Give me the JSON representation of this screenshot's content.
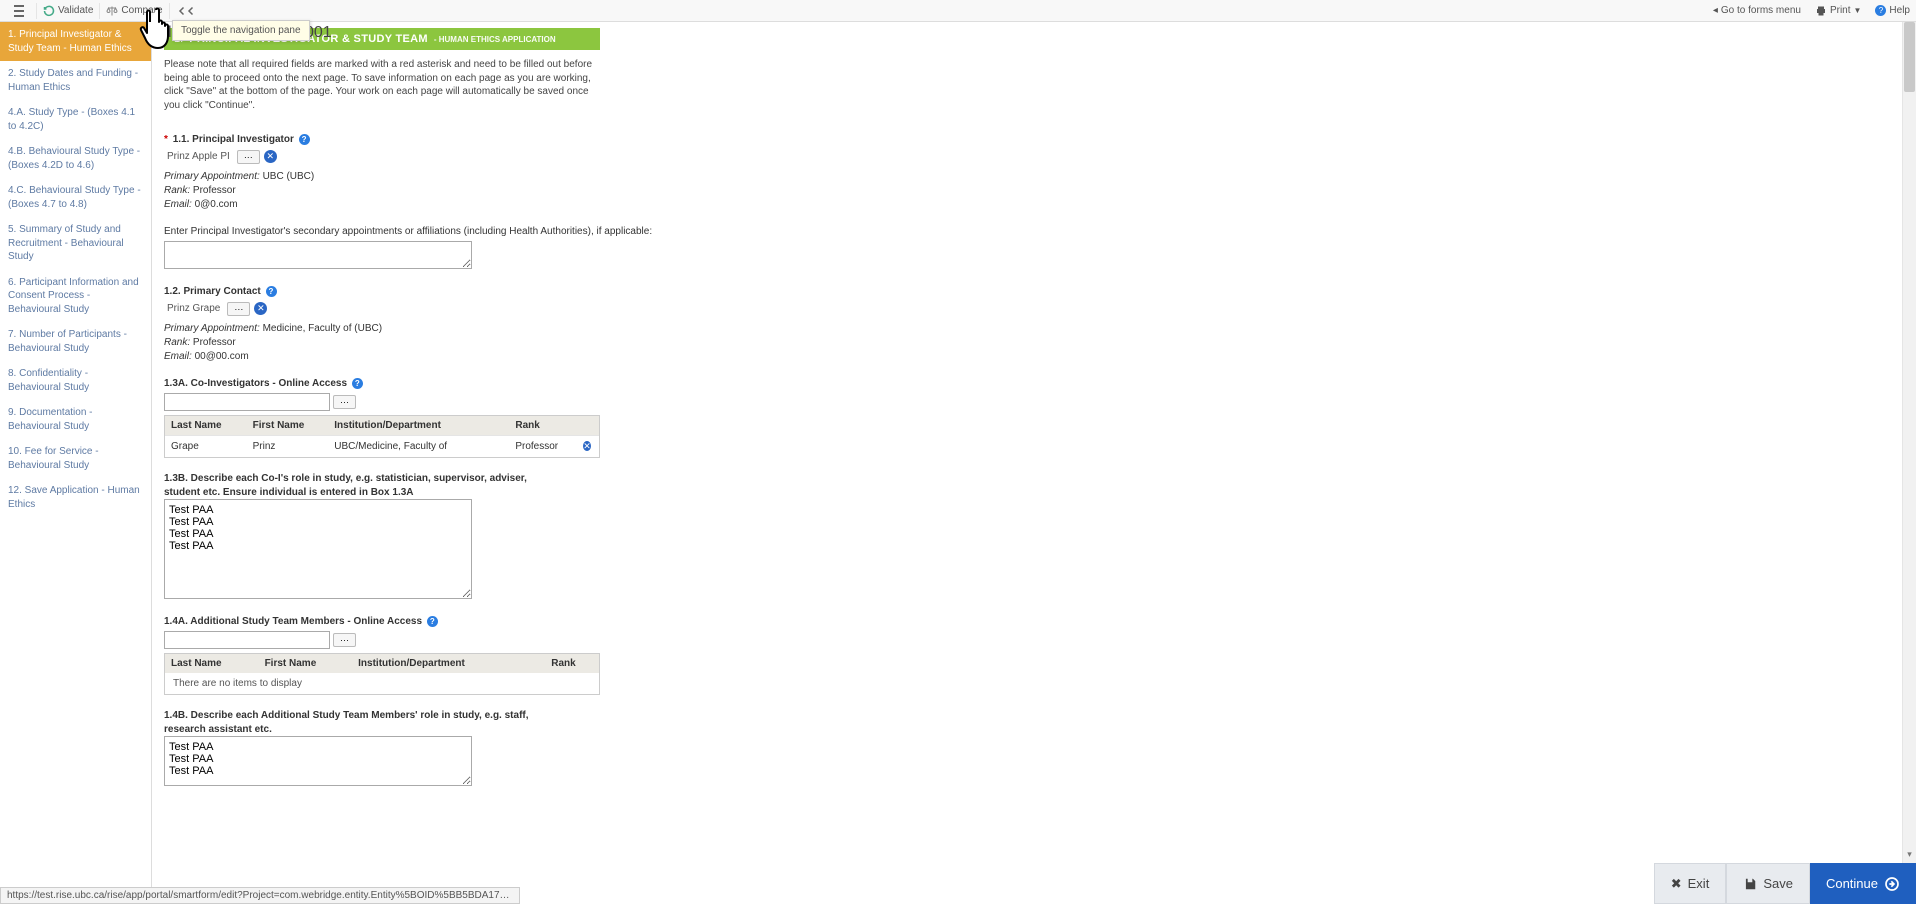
{
  "topbar": {
    "validate": "Validate",
    "compare": "Compare",
    "go_forms": "Go to forms menu",
    "print": "Print",
    "help": "Help",
    "tooltip": "Toggle the navigation pane"
  },
  "title": "Editing: H00-00019-A001",
  "banner": {
    "num": "1.",
    "title": "PRINCIPAL INVESTIGATOR & STUDY TEAM",
    "sub": "- HUMAN ETHICS APPLICATION"
  },
  "note": "Please note that all required fields are marked with a red asterisk and need to be filled out before being able to proceed onto the next page. To save information on each page as you are working, click \"Save\" at the bottom of the page. Your work on each page will automatically be saved once you click \"Continue\".",
  "nav": [
    "1. Principal Investigator & Study Team - Human Ethics",
    "2. Study Dates and Funding - Human Ethics",
    "4.A. Study Type - (Boxes 4.1 to 4.2C)",
    "4.B. Behavioural Study Type - (Boxes 4.2D to 4.6)",
    "4.C. Behavioural Study Type - (Boxes 4.7 to 4.8)",
    "5. Summary of Study and Recruitment - Behavioural Study",
    "6. Participant Information and Consent Process - Behavioural Study",
    "7. Number of Participants - Behavioural Study",
    "8. Confidentiality - Behavioural Study",
    "9. Documentation - Behavioural Study",
    "10. Fee for Service - Behavioural Study",
    "12. Save Application - Human Ethics"
  ],
  "f11": {
    "label": "1.1. Principal Investigator",
    "name": "Prinz Apple PI",
    "primary_appt_label": "Primary Appointment:",
    "primary_appt": "UBC (UBC)",
    "rank_label": "Rank:",
    "rank": "Professor",
    "email_label": "Email:",
    "email": "0@0.com",
    "secondary_label": "Enter Principal Investigator's secondary appointments or affiliations (including Health Authorities), if applicable:"
  },
  "f12": {
    "label": "1.2. Primary Contact",
    "name": "Prinz Grape",
    "primary_appt_label": "Primary Appointment:",
    "primary_appt": "Medicine, Faculty of (UBC)",
    "rank_label": "Rank:",
    "rank": "Professor",
    "email_label": "Email:",
    "email": "00@00.com"
  },
  "f13a": {
    "label": "1.3A. Co-Investigators - Online Access",
    "headers": {
      "last": "Last Name",
      "first": "First Name",
      "inst": "Institution/Department",
      "rank": "Rank"
    },
    "rows": [
      {
        "last": "Grape",
        "first": "Prinz",
        "inst": "UBC/Medicine, Faculty of",
        "rank": "Professor"
      }
    ]
  },
  "f13b": {
    "label": "1.3B. Describe each Co-I's role in study, e.g. statistician, supervisor, adviser, student etc. Ensure individual is entered in Box 1.3A",
    "value": "Test PAA\nTest PAA\nTest PAA\nTest PAA"
  },
  "f14a": {
    "label": "1.4A. Additional Study Team Members - Online Access",
    "headers": {
      "last": "Last Name",
      "first": "First Name",
      "inst": "Institution/Department",
      "rank": "Rank"
    },
    "empty": "There are no items to display"
  },
  "f14b": {
    "label": "1.4B. Describe each Additional Study Team Members' role in study, e.g. staff, research assistant etc.",
    "value": "Test PAA\nTest PAA\nTest PAA"
  },
  "footer": {
    "exit": "Exit",
    "save": "Save",
    "continue": "Continue"
  },
  "status_url": "https://test.rise.ubc.ca/rise/app/portal/smartform/edit?Project=com.webridge.entity.Entity%5BOID%5BB5BDA175D62..."
}
